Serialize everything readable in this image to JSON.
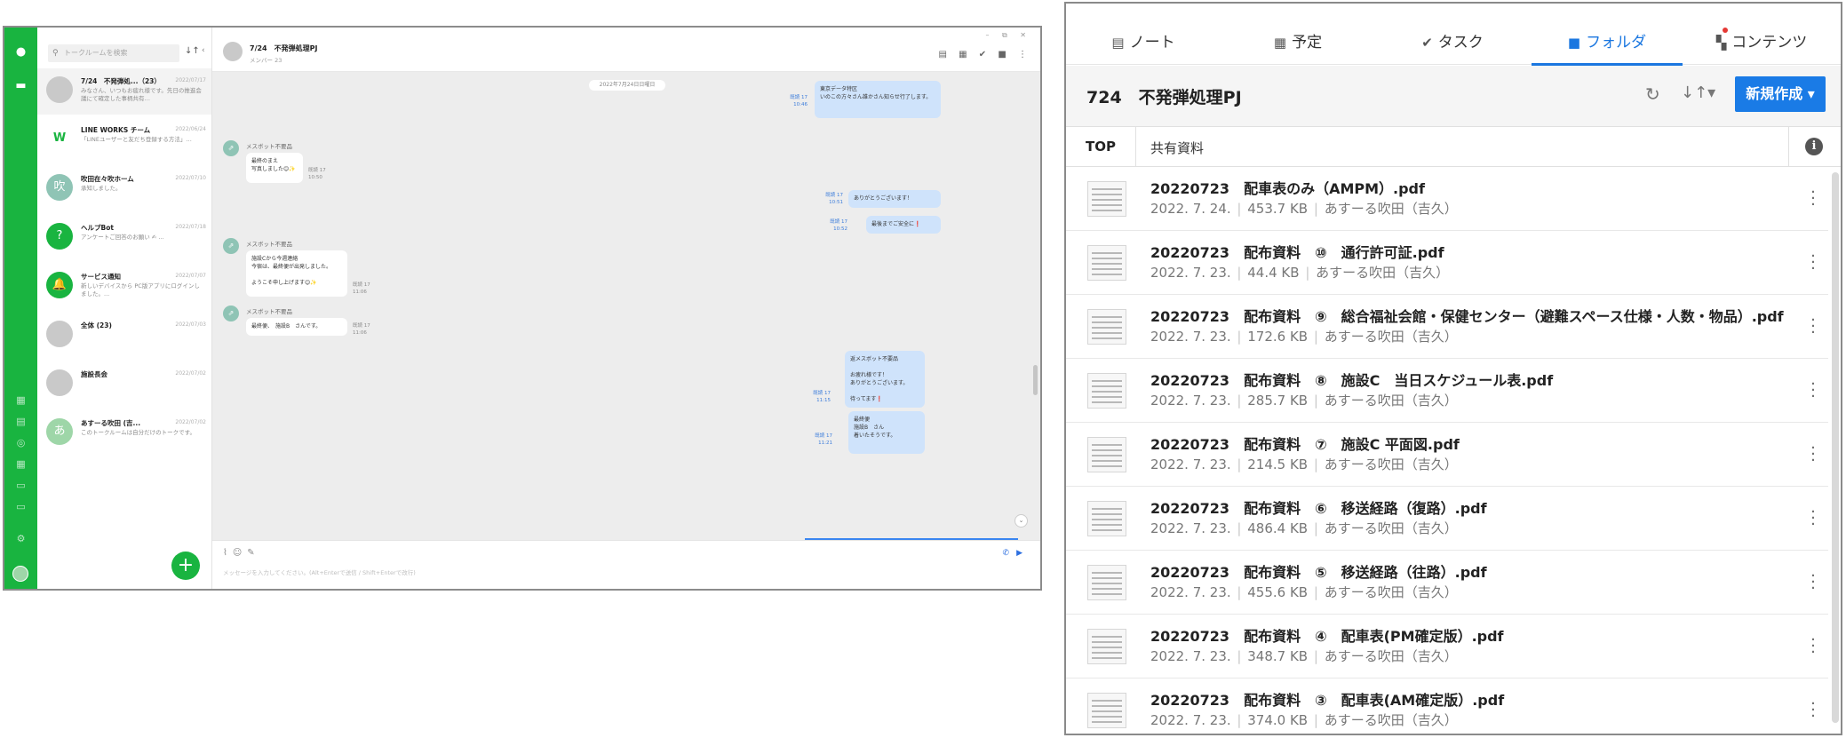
{
  "messenger": {
    "search_placeholder": "トークルームを検索",
    "rooms": [
      {
        "name": "7/24　不発弾処...（23）",
        "time": "2022/07/17",
        "preview": "みなさん、いつもお疲れ様です。先日の推進会議にて確定した事柄共有…",
        "avatar_text": "",
        "color": "#c9c9c9"
      },
      {
        "name": "LINE WORKS チーム",
        "time": "2022/06/24",
        "preview": "「LINEユーザーと友だち登録する方法」…",
        "avatar_text": "W",
        "color": "#ffffff"
      },
      {
        "name": "吹田在々吹ホーム",
        "time": "2022/07/10",
        "preview": "承知しました。",
        "avatar_text": "吹",
        "color": "#8fc4b5"
      },
      {
        "name": "ヘルプBot",
        "time": "2022/07/18",
        "preview": "アンケートご回答のお願い ✍ ...",
        "avatar_text": "?",
        "color": "#19b440"
      },
      {
        "name": "サービス通知",
        "time": "2022/07/07",
        "preview": "新しいデバイスから PC版アプリにログインしました。...",
        "avatar_text": "🔔",
        "color": "#19b440"
      },
      {
        "name": "全体 (23)",
        "time": "2022/07/03",
        "preview": "",
        "avatar_text": "",
        "color": "#c9c9c9"
      },
      {
        "name": "施設長会",
        "time": "2022/07/02",
        "preview": "",
        "avatar_text": "",
        "color": "#c9c9c9"
      },
      {
        "name": "あすーる吹田 (吉...",
        "time": "2022/07/02",
        "preview": "このトークルームは自分だけのトークです。",
        "avatar_text": "あ",
        "color": "#9ed6a8"
      }
    ],
    "chat_title": "7/24　不発弾処理PJ",
    "chat_members": "メンバー 23",
    "date_label": "2022年7月24日日曜日",
    "bot_name": "メスボット不要品",
    "messages": {
      "out1": "東京データ特区\nいのこの方々さん誰かさん知らせ行了します。",
      "out1_meta": "既読 17\n10:46",
      "in1": "最終のまえ\n写真しました😊✨",
      "in1_meta": "既読 17\n10:50",
      "out2": "ありがとうございます！",
      "out2_meta": "既読 17\n10:51",
      "out3": "最後までご安全に❗",
      "out3_meta": "既読 17\n10:52",
      "in2": "施設Cから今週連絡\n今宿は、最終便が出発しました。\n\nようこそ申し上げます😊✨",
      "in2_meta": "既読 17\n11:06",
      "in3": "最終便、　施設B　さんです。",
      "in3_meta": "既読 17\n11:06",
      "out4": "返メスボット不要品\n\nお疲れ様です！\nありがとうございます。\n\n待ってます❗",
      "out4_meta": "既読 17\n11:15",
      "out5": "最終便\n施設B　さん\n着いたそうです。",
      "out5_meta": "既読 17\n11:21"
    },
    "composer_placeholder": "メッセージを入力してください。(Alt+Enterで送信 / Shift+Enterで改行)"
  },
  "folder": {
    "tabs": [
      {
        "label": "ノート",
        "icon": "note-icon",
        "glyph": "▤"
      },
      {
        "label": "予定",
        "icon": "calendar-icon",
        "glyph": "▦"
      },
      {
        "label": "タスク",
        "icon": "check-circle-icon",
        "glyph": "✔"
      },
      {
        "label": "フォルダ",
        "icon": "folder-icon",
        "glyph": "■"
      },
      {
        "label": "コンテンツ",
        "icon": "grid-icon",
        "glyph": "▚"
      }
    ],
    "active_tab": "フォルダ",
    "title": "724　不発弾処理PJ",
    "new_button": "新規作成",
    "crumb_top": "TOP",
    "crumb_current": "共有資料",
    "accent_color": "#1a7be6",
    "files": [
      {
        "name": "20220723　配車表のみ（AMPM）.pdf",
        "date": "2022. 7. 24.",
        "size": "453.7 KB",
        "owner": "あすーる吹田（吉久）"
      },
      {
        "name": "20220723　配布資料　⑩　通行許可証.pdf",
        "date": "2022. 7. 23.",
        "size": "44.4 KB",
        "owner": "あすーる吹田（吉久）"
      },
      {
        "name": "20220723　配布資料　⑨　総合福祉会館・保健センター（避難スペース仕様・人数・物品）.pdf",
        "date": "2022. 7. 23.",
        "size": "172.6 KB",
        "owner": "あすーる吹田（吉久）"
      },
      {
        "name": "20220723　配布資料　⑧　施設C　当日スケジュール表.pdf",
        "date": "2022. 7. 23.",
        "size": "285.7 KB",
        "owner": "あすーる吹田（吉久）"
      },
      {
        "name": "20220723　配布資料　⑦　施設C 平面図.pdf",
        "date": "2022. 7. 23.",
        "size": "214.5 KB",
        "owner": "あすーる吹田（吉久）"
      },
      {
        "name": "20220723　配布資料　⑥　移送経路（復路）.pdf",
        "date": "2022. 7. 23.",
        "size": "486.4 KB",
        "owner": "あすーる吹田（吉久）"
      },
      {
        "name": "20220723　配布資料　⑤　移送経路（往路）.pdf",
        "date": "2022. 7. 23.",
        "size": "455.6 KB",
        "owner": "あすーる吹田（吉久）"
      },
      {
        "name": "20220723　配布資料　④　配車表(PM確定版）.pdf",
        "date": "2022. 7. 23.",
        "size": "348.7 KB",
        "owner": "あすーる吹田（吉久）"
      },
      {
        "name": "20220723　配布資料　③　配車表(AM確定版）.pdf",
        "date": "2022. 7. 23.",
        "size": "374.0 KB",
        "owner": "あすーる吹田（吉久）"
      }
    ]
  }
}
